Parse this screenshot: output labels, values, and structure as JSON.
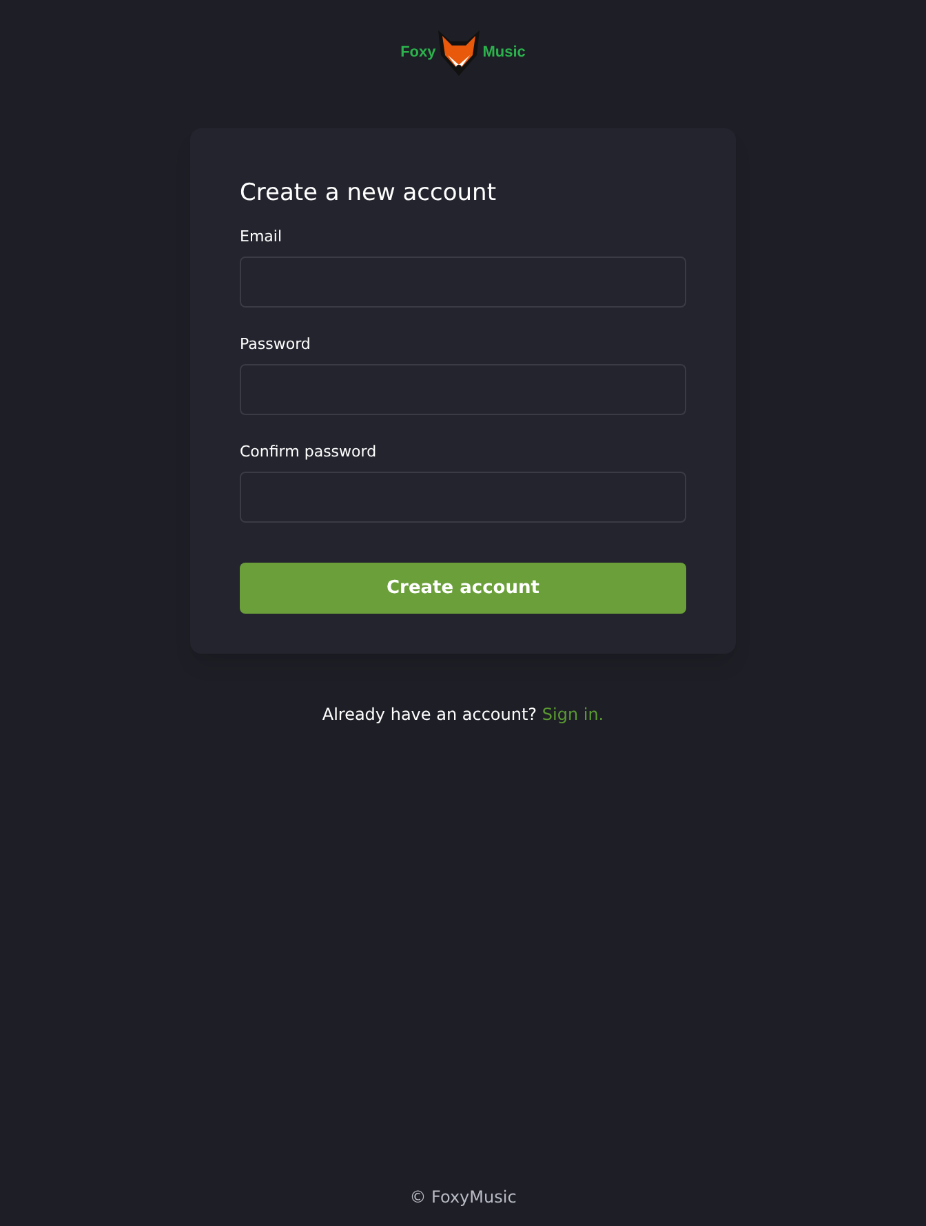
{
  "logo": {
    "left_text": "Foxy",
    "right_text": "Music"
  },
  "form": {
    "title": "Create a new account",
    "fields": [
      {
        "label": "Email"
      },
      {
        "label": "Password"
      },
      {
        "label": "Confirm password"
      }
    ],
    "submit_button": "Create account"
  },
  "signin_prompt": {
    "text": "Already have an account?",
    "link": "Sign in."
  },
  "footer": {
    "copyright_symbol": "©",
    "text": "FoxyMusic"
  }
}
